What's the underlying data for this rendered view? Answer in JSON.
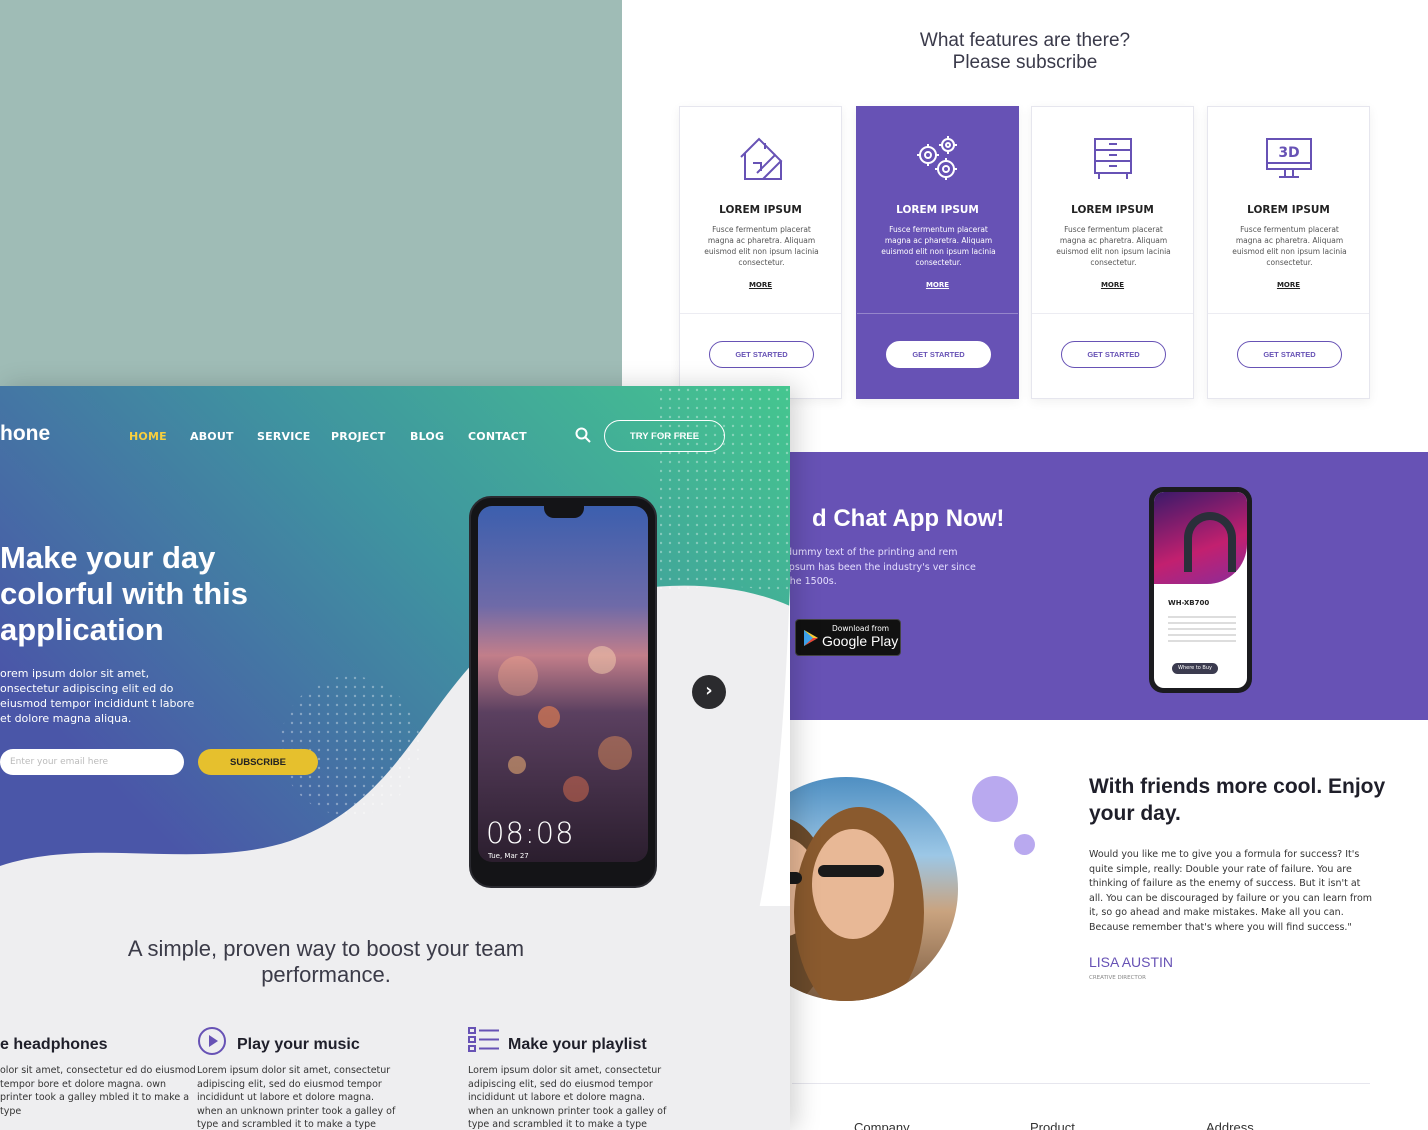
{
  "features": {
    "title_line1": "What features are there?",
    "title_line2": "Please subscribe",
    "cards": [
      {
        "title": "LOREM IPSUM",
        "desc": "Fusce fermentum placerat magna ac pharetra. Aliquam euismod elit non ipsum lacinia consectetur.",
        "more": "MORE",
        "button": "GET STARTED",
        "icon": "house-blueprint-icon"
      },
      {
        "title": "LOREM IPSUM",
        "desc": "Fusce fermentum placerat magna ac pharetra. Aliquam euismod elit non ipsum lacinia consectetur.",
        "more": "MORE",
        "button": "GET STARTED",
        "icon": "gears-icon"
      },
      {
        "title": "LOREM IPSUM",
        "desc": "Fusce fermentum placerat magna ac pharetra. Aliquam euismod elit non ipsum lacinia consectetur.",
        "more": "MORE",
        "button": "GET STARTED",
        "icon": "cabinet-icon"
      },
      {
        "title": "LOREM IPSUM",
        "desc": "Fusce fermentum placerat magna ac pharetra. Aliquam euismod elit non ipsum lacinia consectetur.",
        "more": "MORE",
        "button": "GET STARTED",
        "icon": "3d-monitor-icon"
      }
    ],
    "icon_3d_label": "3D"
  },
  "chat": {
    "title": "d Chat App Now!",
    "text": "dummy text of the printing and rem Ipsum has been the industry's ver since the 1500s.",
    "store_small": "Download from",
    "store_big": "Google Play",
    "phone_model": "WH-XB700",
    "phone_button": "Where to Buy"
  },
  "friends": {
    "title": "With friends more cool. Enjoy your day.",
    "text": "Would you like me to give you a formula for success? It's quite simple, really: Double your rate of failure. You are thinking of failure as the enemy of success. But it isn't at all. You can be discouraged by failure or you can learn from it, so go ahead and make mistakes. Make all you can. Because remember that's where you will find success.\"",
    "author": "LISA AUSTIN",
    "role": "CREATIVE DIRECTOR"
  },
  "footer": {
    "col1": "Company",
    "col2": "Product",
    "col3": "Address"
  },
  "front": {
    "logo": "hone",
    "nav": [
      "HOME",
      "ABOUT",
      "SERVICE",
      "PROJECT",
      "BLOG",
      "CONTACT"
    ],
    "try_button": "TRY FOR FREE",
    "hero_title": "Make your day colorful with this application",
    "hero_text": "orem ipsum dolor sit amet, onsectetur adipiscing elit ed do eiusmod tempor incididunt t labore et dolore magna aliqua.",
    "email_placeholder": "Enter your email here",
    "subscribe": "SUBSCRIBE",
    "phone_time": "08:08",
    "phone_date": "Tue, Mar 27",
    "boost_title": "A simple, proven way to boost your team performance.",
    "features": [
      {
        "title": "e headphones",
        "text": "olor sit amet, consectetur ed do eiusmod tempor bore et dolore magna. own printer took a galley mbled it to make a type",
        "icon": ""
      },
      {
        "title": "Play your music",
        "text": "Lorem ipsum dolor sit amet, consectetur adipiscing elit, sed do eiusmod tempor incididunt ut labore et dolore magna. when an unknown printer took a galley of type and scrambled it to make a type",
        "icon": "play-circle-icon"
      },
      {
        "title": "Make your playlist",
        "text": "Lorem ipsum dolor sit amet, consectetur adipiscing elit, sed do eiusmod tempor incididunt ut labore et dolore magna. when an unknown printer took a galley of type and scrambled it to make a type",
        "icon": "playlist-icon"
      }
    ]
  },
  "colors": {
    "accent_purple": "#6752b5",
    "accent_yellow": "#e6c02d",
    "hero_teal": "#3fbf9a",
    "background_sage": "#9fbcb6"
  }
}
